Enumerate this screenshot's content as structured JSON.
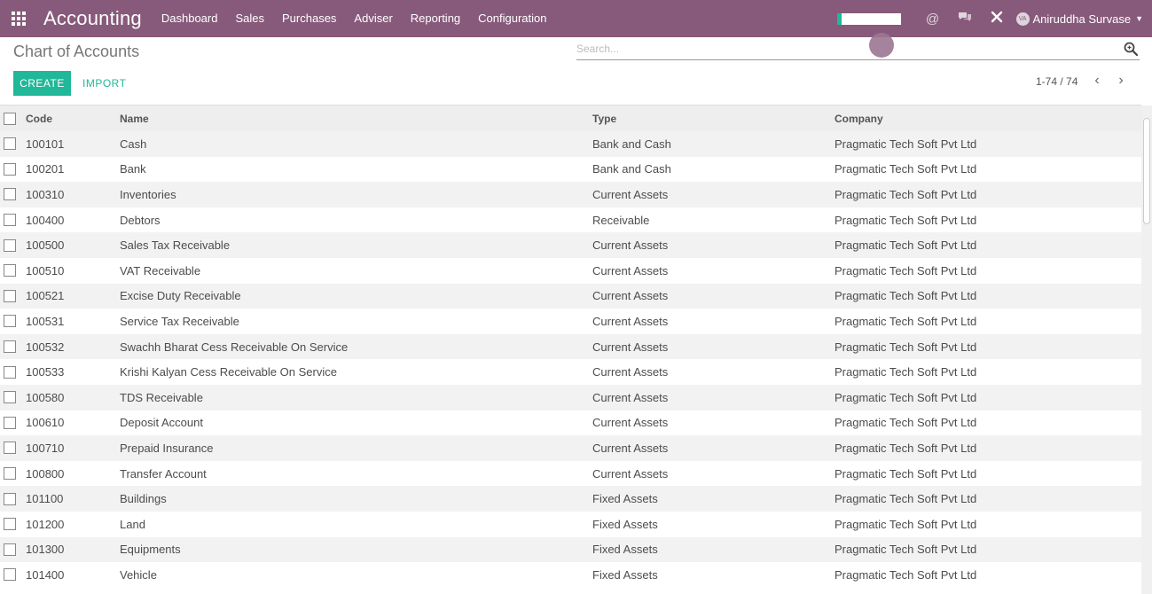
{
  "navbar": {
    "app_title": "Accounting",
    "menu": [
      "Dashboard",
      "Sales",
      "Purchases",
      "Adviser",
      "Reporting",
      "Configuration"
    ],
    "user_name": "Aniruddha Survase",
    "user_initials": "VA",
    "accent_color": "#875a7b"
  },
  "control_panel": {
    "breadcrumb": "Chart of Accounts",
    "search_placeholder": "Search...",
    "create_label": "CREATE",
    "import_label": "IMPORT",
    "pager_value": "1-74 / 74",
    "primary_color": "#21b799"
  },
  "list": {
    "columns": [
      "Code",
      "Name",
      "Type",
      "Company"
    ],
    "rows": [
      {
        "code": "100101",
        "name": "Cash",
        "type": "Bank and Cash",
        "company": "Pragmatic Tech Soft Pvt Ltd"
      },
      {
        "code": "100201",
        "name": "Bank",
        "type": "Bank and Cash",
        "company": "Pragmatic Tech Soft Pvt Ltd"
      },
      {
        "code": "100310",
        "name": "Inventories",
        "type": "Current Assets",
        "company": "Pragmatic Tech Soft Pvt Ltd"
      },
      {
        "code": "100400",
        "name": "Debtors",
        "type": "Receivable",
        "company": "Pragmatic Tech Soft Pvt Ltd"
      },
      {
        "code": "100500",
        "name": "Sales Tax Receivable",
        "type": "Current Assets",
        "company": "Pragmatic Tech Soft Pvt Ltd"
      },
      {
        "code": "100510",
        "name": "VAT Receivable",
        "type": "Current Assets",
        "company": "Pragmatic Tech Soft Pvt Ltd"
      },
      {
        "code": "100521",
        "name": "Excise Duty Receivable",
        "type": "Current Assets",
        "company": "Pragmatic Tech Soft Pvt Ltd"
      },
      {
        "code": "100531",
        "name": "Service Tax Receivable",
        "type": "Current Assets",
        "company": "Pragmatic Tech Soft Pvt Ltd"
      },
      {
        "code": "100532",
        "name": "Swachh Bharat Cess Receivable On Service",
        "type": "Current Assets",
        "company": "Pragmatic Tech Soft Pvt Ltd"
      },
      {
        "code": "100533",
        "name": "Krishi Kalyan Cess Receivable On Service",
        "type": "Current Assets",
        "company": "Pragmatic Tech Soft Pvt Ltd"
      },
      {
        "code": "100580",
        "name": "TDS Receivable",
        "type": "Current Assets",
        "company": "Pragmatic Tech Soft Pvt Ltd"
      },
      {
        "code": "100610",
        "name": "Deposit Account",
        "type": "Current Assets",
        "company": "Pragmatic Tech Soft Pvt Ltd"
      },
      {
        "code": "100710",
        "name": "Prepaid Insurance",
        "type": "Current Assets",
        "company": "Pragmatic Tech Soft Pvt Ltd"
      },
      {
        "code": "100800",
        "name": "Transfer Account",
        "type": "Current Assets",
        "company": "Pragmatic Tech Soft Pvt Ltd"
      },
      {
        "code": "101100",
        "name": "Buildings",
        "type": "Fixed Assets",
        "company": "Pragmatic Tech Soft Pvt Ltd"
      },
      {
        "code": "101200",
        "name": "Land",
        "type": "Fixed Assets",
        "company": "Pragmatic Tech Soft Pvt Ltd"
      },
      {
        "code": "101300",
        "name": "Equipments",
        "type": "Fixed Assets",
        "company": "Pragmatic Tech Soft Pvt Ltd"
      },
      {
        "code": "101400",
        "name": "Vehicle",
        "type": "Fixed Assets",
        "company": "Pragmatic Tech Soft Pvt Ltd"
      }
    ]
  }
}
